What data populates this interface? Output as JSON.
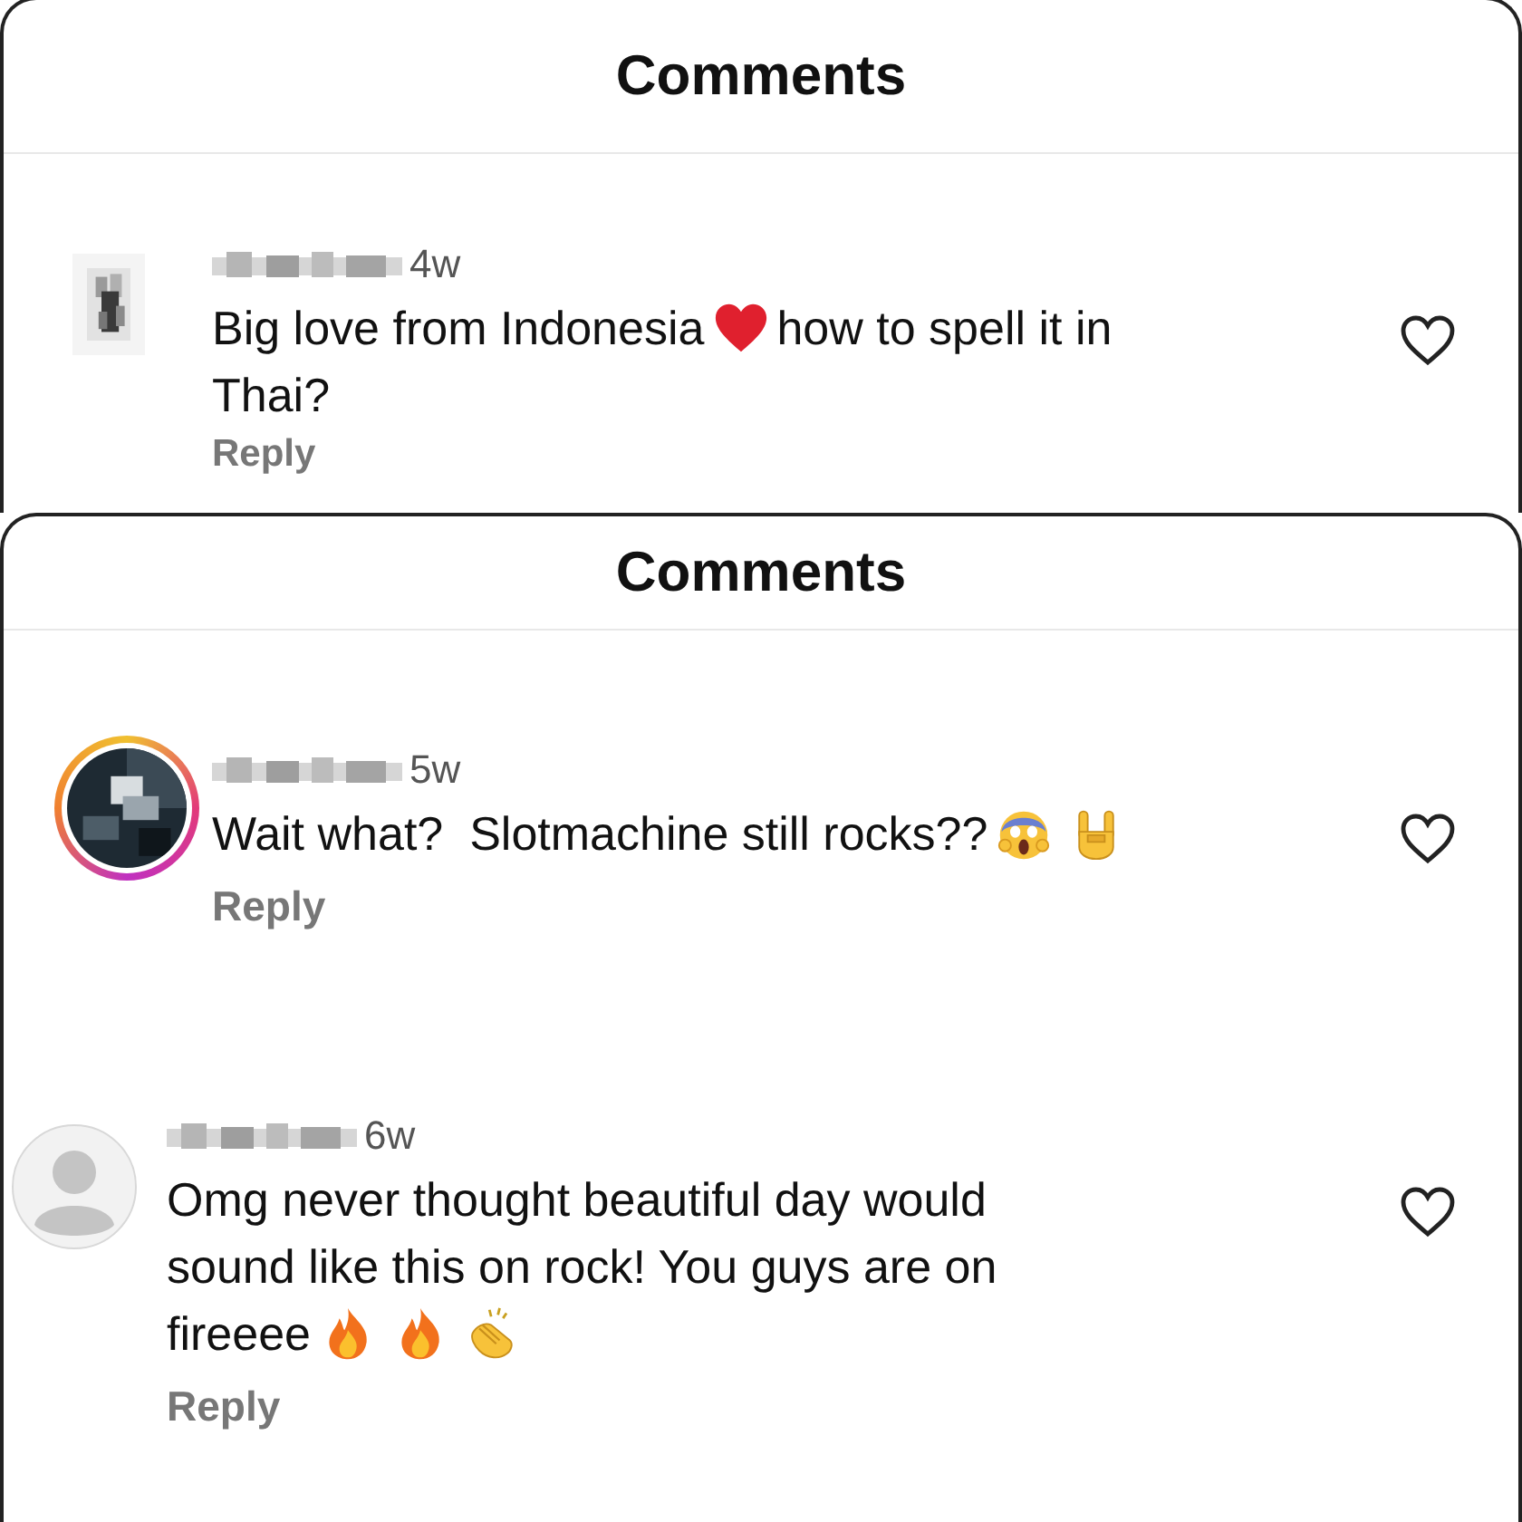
{
  "panels": [
    {
      "title": "Comments",
      "comments": [
        {
          "time": "4w",
          "lines": [
            [
              {
                "kind": "text",
                "text": "Big love from Indonesia"
              },
              {
                "kind": "heart"
              },
              {
                "kind": "text",
                "text": "how to spell it in"
              }
            ],
            [
              {
                "kind": "text",
                "text": "Thai?"
              }
            ]
          ],
          "reply": "Reply"
        }
      ]
    },
    {
      "title": "Comments",
      "comments": [
        {
          "kind": "story",
          "time": "5w",
          "lines": [
            [
              {
                "kind": "text",
                "text": "Wait what?  Slotmachine still rocks??"
              },
              {
                "kind": "scream"
              },
              {
                "kind": "rock"
              }
            ]
          ],
          "reply": "Reply"
        },
        {
          "kind": "default",
          "time": "6w",
          "lines": [
            [
              {
                "kind": "text",
                "text": "Omg never thought beautiful day would"
              }
            ],
            [
              {
                "kind": "text",
                "text": "sound like this on rock! You guys are on"
              }
            ],
            [
              {
                "kind": "text",
                "text": "fireeee"
              },
              {
                "kind": "fire"
              },
              {
                "kind": "fire"
              },
              {
                "kind": "clap"
              }
            ]
          ],
          "reply": "Reply"
        }
      ]
    }
  ]
}
